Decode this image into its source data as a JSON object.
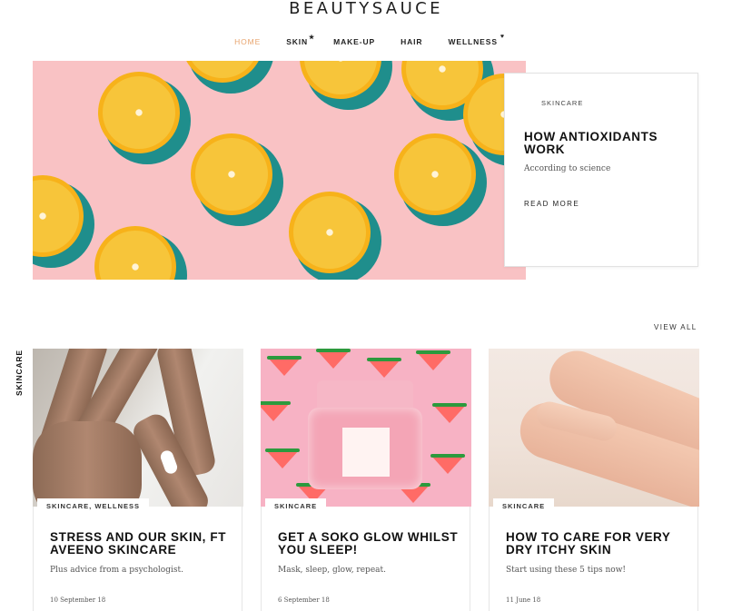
{
  "brand": {
    "logo_text": "BEAUTYSAUCE"
  },
  "nav": {
    "items": [
      {
        "label": "HOME",
        "active": true,
        "marker": ""
      },
      {
        "label": "SKIN",
        "active": false,
        "marker": "★"
      },
      {
        "label": "MAKE-UP",
        "active": false,
        "marker": ""
      },
      {
        "label": "HAIR",
        "active": false,
        "marker": ""
      },
      {
        "label": "WELLNESS",
        "active": false,
        "marker": "♥"
      }
    ]
  },
  "feature": {
    "category": "SKINCARE",
    "title": "HOW ANTIOXIDANTS WORK",
    "subtitle": "According to science",
    "cta": "READ MORE"
  },
  "section": {
    "side_label": "SKINCARE",
    "view_all": "VIEW ALL"
  },
  "cards": [
    {
      "tag": "SKINCARE, WELLNESS",
      "title": "STRESS AND OUR SKIN, FT AVEENO SKINCARE",
      "subtitle": "Plus advice from a psychologist.",
      "date": "10 September 18"
    },
    {
      "tag": "SKINCARE",
      "title": "GET A SOKO GLOW WHILST YOU SLEEP!",
      "subtitle": "Mask, sleep, glow, repeat.",
      "date": "6 September 18"
    },
    {
      "tag": "SKINCARE",
      "title": "HOW TO CARE FOR VERY DRY ITCHY SKIN",
      "subtitle": "Start using these 5 tips now!",
      "date": "11 June 18"
    }
  ],
  "colors": {
    "accent": "#e8a46e",
    "hero_bg": "#f9c2c4",
    "orange_peel": "#f7b21a",
    "orange_shadow": "#1f8e8c"
  }
}
